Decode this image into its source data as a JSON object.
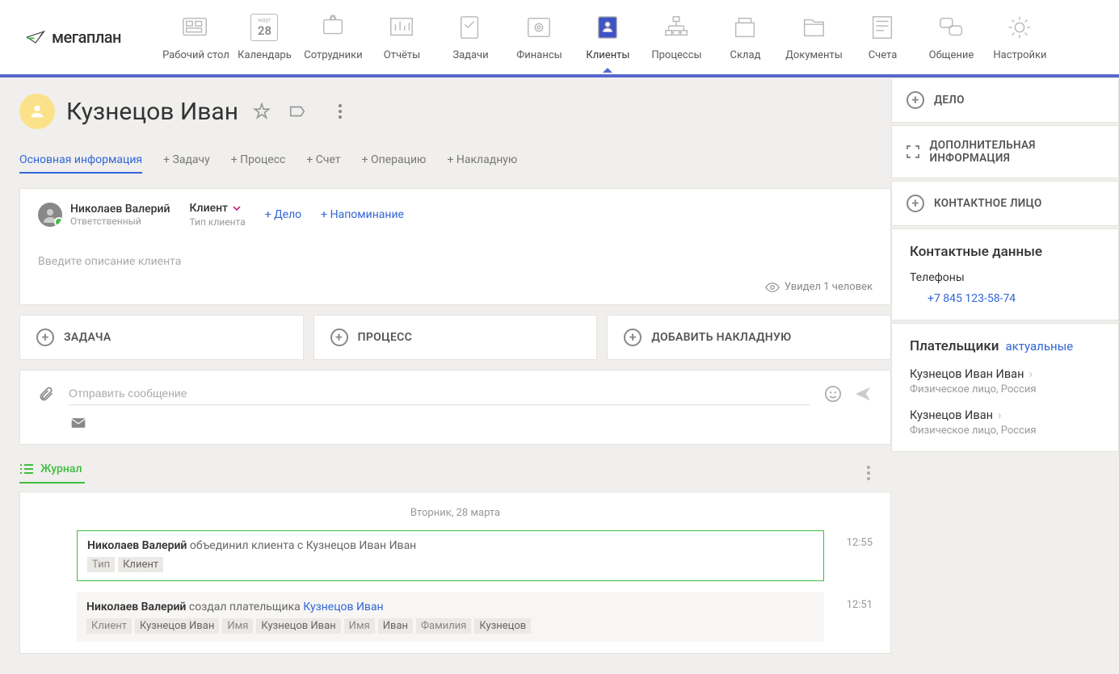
{
  "logo": "мегаплан",
  "nav": [
    {
      "label": "Рабочий стол"
    },
    {
      "label": "Календарь",
      "badge": "28",
      "badge_top": "март"
    },
    {
      "label": "Сотрудники"
    },
    {
      "label": "Отчёты"
    },
    {
      "label": "Задачи"
    },
    {
      "label": "Финансы"
    },
    {
      "label": "Клиенты",
      "active": true
    },
    {
      "label": "Процессы"
    },
    {
      "label": "Склад"
    },
    {
      "label": "Документы"
    },
    {
      "label": "Счета"
    },
    {
      "label": "Общение"
    },
    {
      "label": "Настройки"
    }
  ],
  "page_title": "Кузнецов Иван",
  "tabs": [
    {
      "label": "Основная информация",
      "active": true
    },
    {
      "label": "+ Задачу"
    },
    {
      "label": "+ Процесс"
    },
    {
      "label": "+ Счет"
    },
    {
      "label": "+ Операцию"
    },
    {
      "label": "+ Накладную"
    }
  ],
  "responsible": {
    "name": "Николаев Валерий",
    "role": "Ответственный"
  },
  "client_type": {
    "value": "Клиент",
    "label": "Тип клиента"
  },
  "quick_links": {
    "deal": "+ Дело",
    "reminder": "+ Напоминание"
  },
  "description_placeholder": "Введите описание клиента",
  "seen_text": "Увидел 1 человек",
  "actions": {
    "task": "ЗАДАЧА",
    "process": "ПРОЦЕСС",
    "invoice": "ДОБАВИТЬ НАКЛАДНУЮ"
  },
  "composer_placeholder": "Отправить сообщение",
  "journal_label": "Журнал",
  "journal_date": "Вторник, 28 марта",
  "entries": [
    {
      "time": "12:55",
      "author": "Николаев Валерий",
      "action": " объединил клиента с Кузнецов Иван Иван",
      "highlighted": true,
      "tags": [
        [
          "Тип",
          "Клиент"
        ]
      ]
    },
    {
      "time": "12:51",
      "author": "Николаев Валерий",
      "action_pre": " создал  плательщика ",
      "link": "Кузнецов Иван",
      "tags": [
        [
          "Клиент",
          "Кузнецов Иван"
        ],
        [
          "Имя",
          "Кузнецов Иван"
        ],
        [
          "Имя",
          "Иван"
        ],
        [
          "Фамилия",
          "Кузнецов"
        ]
      ]
    }
  ],
  "side_actions": {
    "deal": "ДЕЛО",
    "extra": "ДОПОЛНИТЕЛЬНАЯ ИНФОРМАЦИЯ",
    "contact": "КОНТАКТНОЕ ЛИЦО"
  },
  "contact": {
    "heading": "Контактные данные",
    "phones_label": "Телефоны",
    "phone": "+7 845 123-58-74"
  },
  "payers": {
    "heading": "Плательщики",
    "filter": "актуальные",
    "list": [
      {
        "name": "Кузнецов Иван Иван",
        "meta": "Физическое лицо, Россия"
      },
      {
        "name": "Кузнецов Иван",
        "meta": "Физическое лицо, Россия"
      }
    ]
  }
}
